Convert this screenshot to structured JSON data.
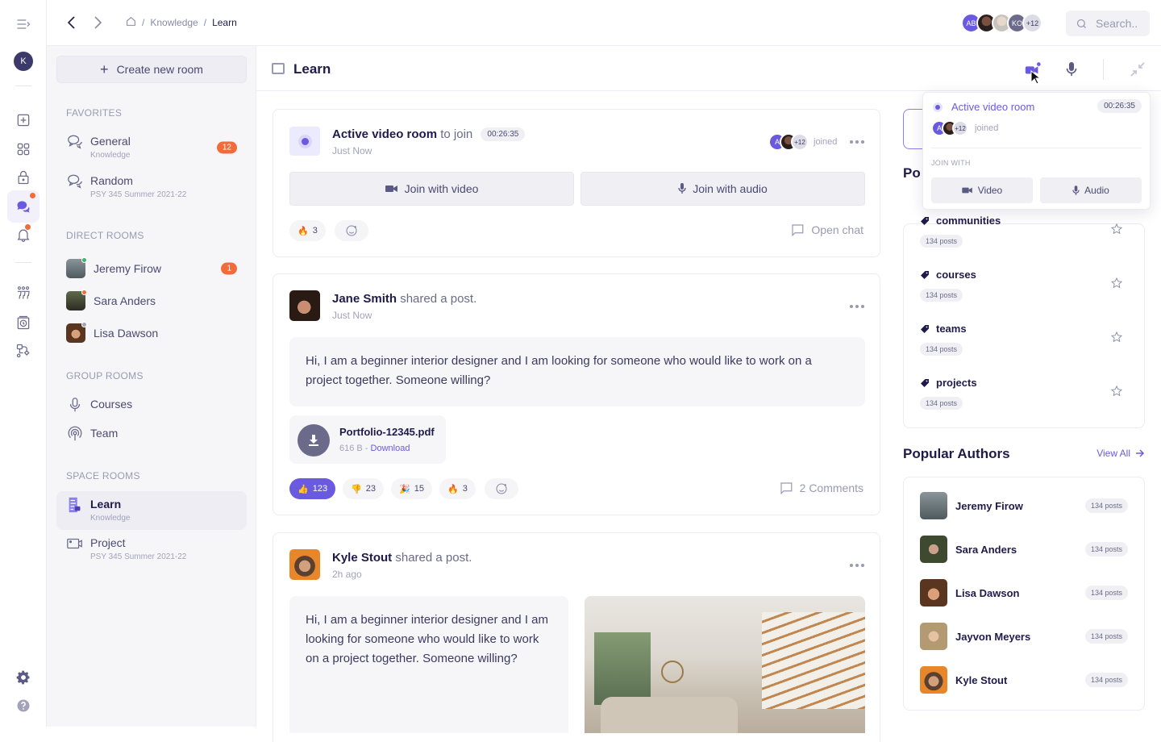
{
  "topbar": {
    "breadcrumb": [
      "Knowledge",
      "Learn"
    ],
    "participants": [
      {
        "initials": "AB",
        "color": "#6a5ae0"
      },
      {
        "initials": "",
        "color": "#3a2f2c"
      },
      {
        "initials": "",
        "color": "#c9c3bd"
      },
      {
        "initials": "KO",
        "color": "#6b6a8a"
      },
      {
        "initials": "+12",
        "color": "#e4e4ec"
      }
    ],
    "search_placeholder": "Search.."
  },
  "rail": {
    "user_initial": "K"
  },
  "sidebar": {
    "create_label": "Create new room",
    "favorites_title": "FAVORITES",
    "favorites": [
      {
        "name": "General",
        "sub": "Knowledge",
        "badge": "12"
      },
      {
        "name": "Random",
        "sub": "PSY 345 Summer 2021-22",
        "badge": ""
      }
    ],
    "direct_title": "DIRECT ROOMS",
    "direct": [
      {
        "name": "Jeremy Firow",
        "badge": "1",
        "status": "#3bb273",
        "color": "#6e7a80"
      },
      {
        "name": "Sara Anders",
        "badge": "",
        "status": "#f26b3a",
        "color": "#4a4a3a"
      },
      {
        "name": "Lisa Dawson",
        "badge": "",
        "status": "#a3a2ba",
        "color": "#8a5a3a"
      }
    ],
    "group_title": "GROUP ROOMS",
    "group": [
      {
        "name": "Courses"
      },
      {
        "name": "Team"
      }
    ],
    "space_title": "SPACE ROOMS",
    "space": [
      {
        "name": "Learn",
        "sub": "Knowledge"
      },
      {
        "name": "Project",
        "sub": "PSY 345 Summer 2021-22"
      }
    ]
  },
  "main": {
    "title": "Learn",
    "room_card": {
      "title_bold": "Active video room",
      "title_rest": "to join",
      "timer": "00:26:35",
      "time": "Just Now",
      "joined_label": "joined",
      "joined_more": "+12",
      "join_video": "Join with video",
      "join_audio": "Join with audio",
      "reaction_count": "3",
      "open_chat": "Open chat"
    },
    "post1": {
      "author": "Jane Smith",
      "action": "shared a post.",
      "time": "Just Now",
      "text": "Hi, I am a beginner interior designer and I am looking for someone who would like to work on a project together. Someone willing?",
      "file_name": "Portfolio-12345.pdf",
      "file_size": "616 B -",
      "download": "Download",
      "reactions": [
        {
          "emoji": "👍",
          "count": "123",
          "active": true
        },
        {
          "emoji": "👎",
          "count": "23",
          "active": false
        },
        {
          "emoji": "🎉",
          "count": "15",
          "active": false
        },
        {
          "emoji": "🔥",
          "count": "3",
          "active": false
        }
      ],
      "comments": "2 Comments"
    },
    "post2": {
      "author": "Kyle Stout",
      "action": "shared a post.",
      "time": "2h ago",
      "text": "Hi, I am a beginner interior designer and I am looking for someone who would like to work on a project together. Someone willing?"
    }
  },
  "popup": {
    "title": "Active video room",
    "timer": "00:26:35",
    "joined_label": "joined",
    "joined_more": "+12",
    "join_with": "JOIN WITH",
    "video": "Video",
    "audio": "Audio"
  },
  "right": {
    "tags_title_partial": "Po",
    "tags": [
      {
        "name": "communities",
        "posts": "134 posts"
      },
      {
        "name": "courses",
        "posts": "134 posts"
      },
      {
        "name": "teams",
        "posts": "134 posts"
      },
      {
        "name": "projects",
        "posts": "134 posts"
      }
    ],
    "authors_title": "Popular Authors",
    "view_all": "View All",
    "authors": [
      {
        "name": "Jeremy Firow",
        "posts": "134 posts",
        "color": "#6e7a80"
      },
      {
        "name": "Sara Anders",
        "posts": "134 posts",
        "color": "#4a4a3a"
      },
      {
        "name": "Lisa Dawson",
        "posts": "134 posts",
        "color": "#8a5a3a"
      },
      {
        "name": "Jayvon Meyers",
        "posts": "134 posts",
        "color": "#b49a72"
      },
      {
        "name": "Kyle Stout",
        "posts": "134 posts",
        "color": "#6a4a36"
      }
    ]
  }
}
